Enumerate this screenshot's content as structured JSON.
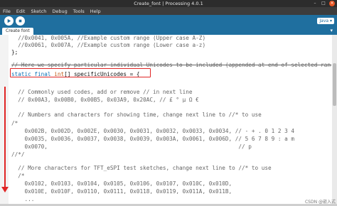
{
  "window": {
    "title": "Create_font | Processing 4.0.1",
    "minimize": "–",
    "maximize": "□",
    "close": "×"
  },
  "menu": [
    "File",
    "Edit",
    "Sketch",
    "Debug",
    "Tools",
    "Help"
  ],
  "toolbar": {
    "run_icon": "play-icon",
    "stop_icon": "stop-icon",
    "mode": "Java ▾"
  },
  "tabs": [
    {
      "label": "Create font"
    }
  ],
  "tab_menu_arrow": "▾",
  "code_lines": [
    "  //0x0041, 0x005A, //Example custom range (Upper case A-Z)",
    "  //0x0061, 0x007A, //Example custom range (Lower case a-z)",
    "};",
    "",
    "// Here we specify particular individual Unicodes to be included (appended at end of selected range)",
    "static final int[] specificUnicodes = {",
    "",
    "  // Commonly used codes, add or remove // in next line",
    "  // 0x00A3, 0x00B0, 0x00B5, 0x03A9, 0x20AC, // £ ° µ Ω €",
    "",
    "  // Numbers and characters for showing time, change next line to //* to use",
    "/*",
    "    0x002B, 0x002D, 0x002E, 0x0030, 0x0031, 0x0032, 0x0033, 0x0034, // - + . 0 1 2 3 4",
    "    0x0035, 0x0036, 0x0037, 0x0038, 0x0039, 0x003A, 0x0061, 0x006D, // 5 6 7 8 9 : a m",
    "    0x0070,                                                          // p",
    "//*/",
    "",
    "  // More characters for TFT_eSPI test sketches, change next line to //* to use",
    "  /*",
    "    0x0102, 0x0103, 0x0104, 0x0105, 0x0106, 0x0107, 0x010C, 0x010D,",
    "    0x010E, 0x010F, 0x0110, 0x0111, 0x0118, 0x0119, 0x011A, 0x011B,",
    "    ..."
  ],
  "code_highlight": {
    "keyword_static": "static",
    "keyword_final": "final",
    "type_int": "int",
    "rest": "[] specificUnicodes = {"
  },
  "watermark": "CSDN @嵌入式"
}
